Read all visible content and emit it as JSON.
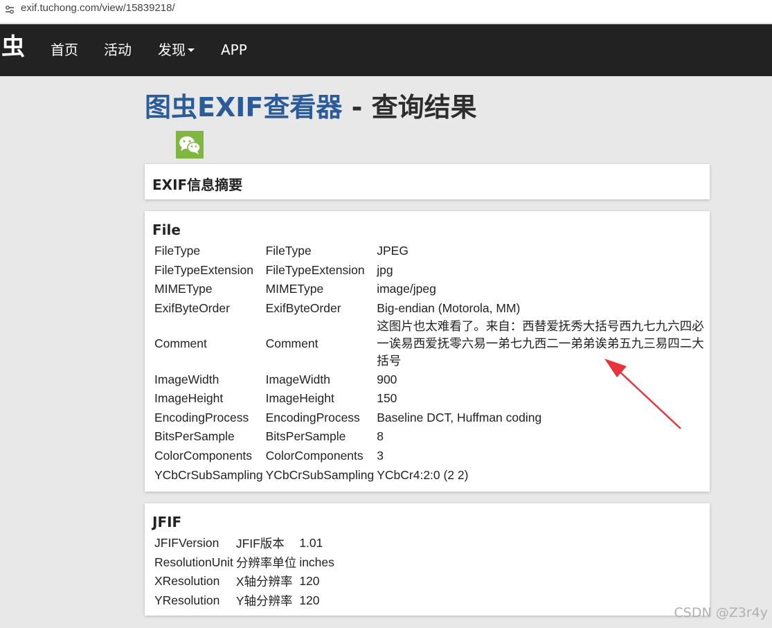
{
  "browser": {
    "url": "exif.tuchong.com/view/15839218/"
  },
  "nav": {
    "logo": "虫",
    "items": [
      "首页",
      "活动",
      "发现",
      "APP"
    ]
  },
  "page": {
    "title_brand": "图虫EXIF查看器",
    "title_rest": " - 查询结果"
  },
  "summary": {
    "title": "EXIF信息摘要"
  },
  "file": {
    "title": "File",
    "rows": [
      [
        "FileType",
        "FileType",
        "JPEG"
      ],
      [
        "FileTypeExtension",
        "FileTypeExtension",
        "jpg"
      ],
      [
        "MIMEType",
        "MIMEType",
        "image/jpeg"
      ],
      [
        "ExifByteOrder",
        "ExifByteOrder",
        "Big-endian (Motorola, MM)"
      ],
      [
        "Comment",
        "Comment",
        "这图片也太难看了。来自：西替爱抚秀大括号西九七九六四必一诶易西爱抚零六易一弟七九西二一弟弟诶弟五九三易四二大括号"
      ],
      [
        "ImageWidth",
        "ImageWidth",
        "900"
      ],
      [
        "ImageHeight",
        "ImageHeight",
        "150"
      ],
      [
        "EncodingProcess",
        "EncodingProcess",
        "Baseline DCT, Huffman coding"
      ],
      [
        "BitsPerSample",
        "BitsPerSample",
        "8"
      ],
      [
        "ColorComponents",
        "ColorComponents",
        "3"
      ],
      [
        "YCbCrSubSampling",
        "YCbCrSubSampling",
        "YCbCr4:2:0 (2 2)"
      ]
    ]
  },
  "jfif": {
    "title": "JFIF",
    "rows": [
      [
        "JFIFVersion",
        "JFIF版本",
        "1.01"
      ],
      [
        "ResolutionUnit",
        "分辨率单位",
        "inches"
      ],
      [
        "XResolution",
        "X轴分辨率",
        "120"
      ],
      [
        "YResolution",
        "Y轴分辨率",
        "120"
      ]
    ]
  },
  "watermark": "CSDN @Z3r4y",
  "colors": {
    "navbar": "#222222",
    "brand": "#2c5b9a",
    "wechat": "#7fb742",
    "arrow": "#e8333a"
  }
}
